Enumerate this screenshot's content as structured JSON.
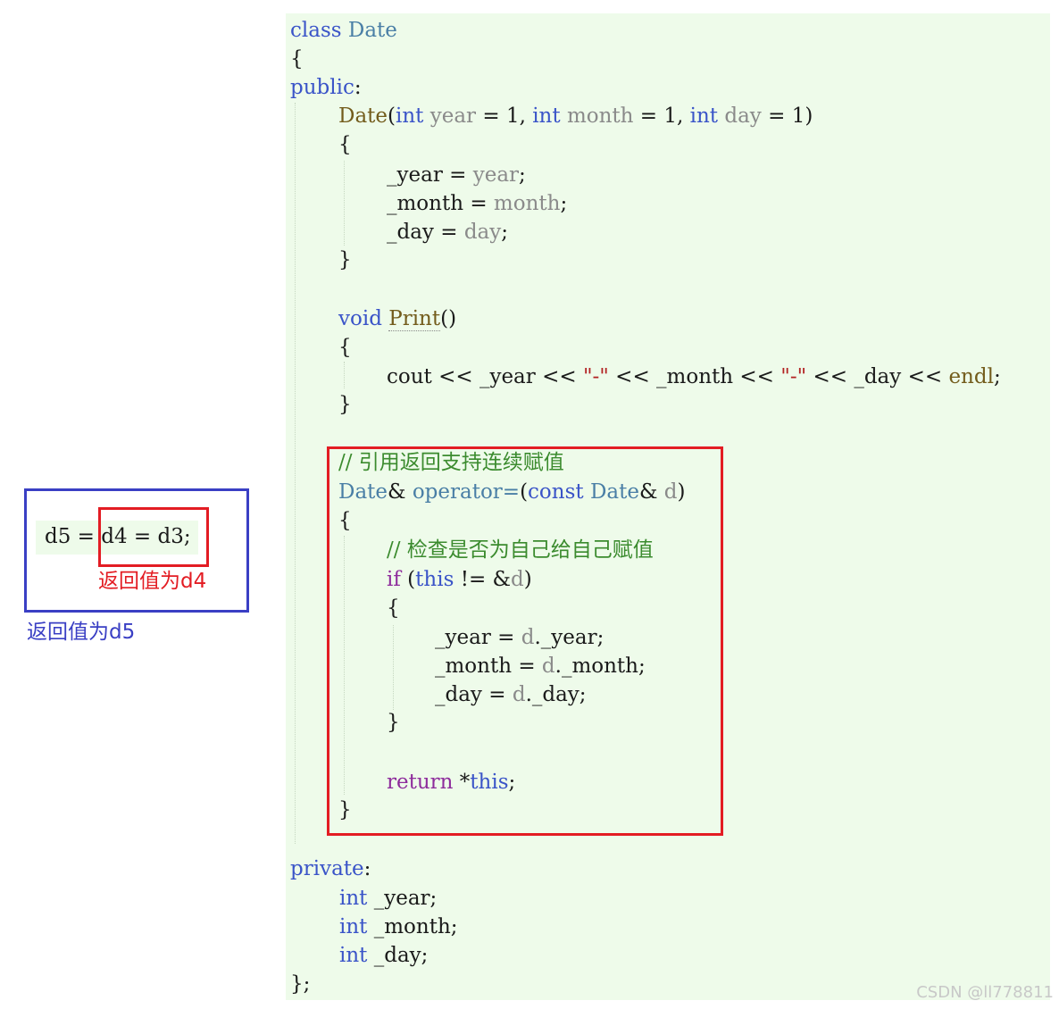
{
  "code": {
    "l1_class": "class",
    "l1_name": "Date",
    "l2_brace": "{",
    "l3_public": "public",
    "l3_colon": ":",
    "l4_ctor": "Date",
    "l4_open": "(",
    "l4_int1": "int",
    "l4_year": "year",
    "l4_eq1": " = 1, ",
    "l4_int2": "int",
    "l4_month": "month",
    "l4_eq2": " = 1, ",
    "l4_int3": "int",
    "l4_day": "day",
    "l4_eq3": " = 1)",
    "l5_brace": "{",
    "l6_lhs": "_year = ",
    "l6_rhs": "year",
    "l6_end": ";",
    "l7_lhs": "_month = ",
    "l7_rhs": "month",
    "l7_end": ";",
    "l8_lhs": "_day = ",
    "l8_rhs": "day",
    "l8_end": ";",
    "l9_brace": "}",
    "l10_void": "void",
    "l10_print": "Print",
    "l10_parens": "()",
    "l11_brace": "{",
    "l12_cout1": "cout << _year << ",
    "l12_dash1": "\"-\"",
    "l12_cout2": " << _month << ",
    "l12_dash2": "\"-\"",
    "l12_cout3": " << _day << ",
    "l12_endl": "endl",
    "l12_end": ";",
    "l13_brace": "}",
    "l14_comment": "// 引用返回支持连续赋值",
    "l15_date": "Date",
    "l15_amp": "& ",
    "l15_op": "operator=",
    "l15_open": "(",
    "l15_const": "const",
    "l15_date2": "Date",
    "l15_amp2": "& ",
    "l15_d": "d",
    "l15_close": ")",
    "l16_brace": "{",
    "l17_comment": "// 检查是否为自己给自己赋值",
    "l18_if": "if",
    "l18_open": " (",
    "l18_this": "this",
    "l18_ne": " != &",
    "l18_d": "d",
    "l18_close": ")",
    "l19_brace": "{",
    "l20_lhs": "_year = ",
    "l20_d": "d",
    "l20_rhs": "._year;",
    "l21_lhs": "_month = ",
    "l21_d": "d",
    "l21_rhs": "._month;",
    "l22_lhs": "_day = ",
    "l22_d": "d",
    "l22_rhs": "._day;",
    "l23_brace": "}",
    "l24_return": "return",
    "l24_star": " *",
    "l24_this": "this",
    "l24_end": ";",
    "l25_brace": "}",
    "l26_private": "private",
    "l26_colon": ":",
    "l27_int": "int",
    "l27_var": " _year;",
    "l28_int": "int",
    "l28_var": " _month;",
    "l29_int": "int",
    "l29_var": " _day;",
    "l30_end": "};"
  },
  "annotation": {
    "snippet_d5": "d5 = ",
    "snippet_d4": "d4 = d3;",
    "label_d4": "返回值为d4",
    "label_d5": "返回值为d5"
  },
  "watermark": "CSDN @ll778811",
  "colors": {
    "keyword": "#3a54c8",
    "type": "#4a7fa6",
    "function": "#735c1c",
    "parameter": "#8a8a8a",
    "string": "#b22222",
    "control": "#8e2c9c",
    "comment": "#3b8b2e",
    "highlight_red": "#e31c23",
    "highlight_blue": "#3a3fc4",
    "code_background": "#eefbea"
  }
}
